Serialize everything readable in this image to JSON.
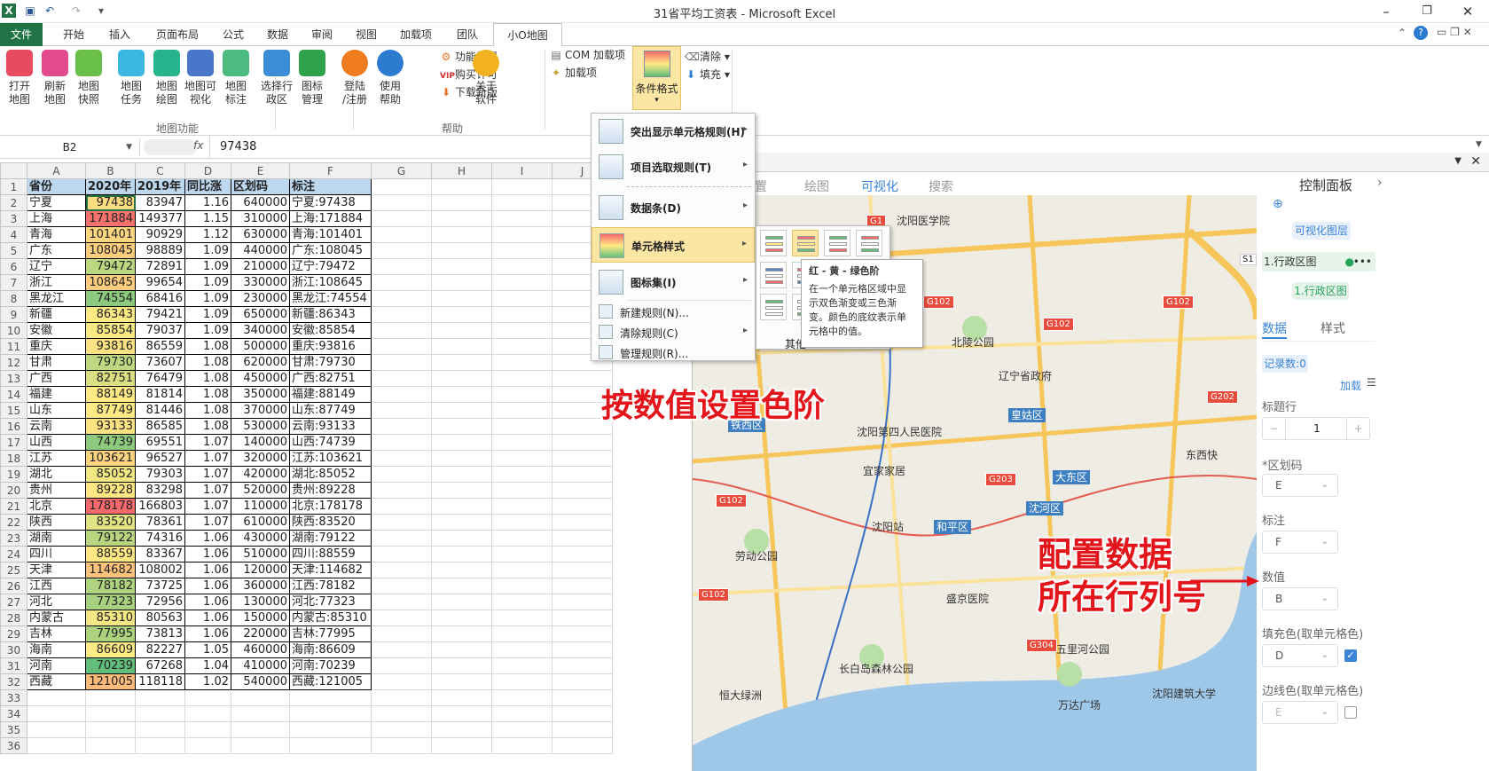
{
  "window": {
    "title": "31省平均工资表 - Microsoft Excel",
    "min": "–",
    "restore": "❐",
    "close": "✕"
  },
  "tabs": [
    "文件",
    "开始",
    "插入",
    "页面布局",
    "公式",
    "数据",
    "审阅",
    "视图",
    "加载项",
    "团队",
    "小O地图"
  ],
  "ribbon": {
    "group1": {
      "label": "地图功能",
      "buttons": [
        {
          "label": "打开\n地图",
          "icon": "flower-icon",
          "color": "#e84a5f"
        },
        {
          "label": "刷新\n地图",
          "icon": "refresh-icon",
          "color": "#e24a8d"
        },
        {
          "label": "地图\n快照",
          "icon": "camera-icon",
          "color": "#6abf4b"
        },
        {
          "label": "地图\n任务",
          "icon": "calendar-icon",
          "color": "#3cb6e3"
        },
        {
          "label": "地图\n绘图",
          "icon": "pen-icon",
          "color": "#27b38b"
        },
        {
          "label": "地图可\n视化",
          "icon": "image-icon",
          "color": "#4a76c9"
        },
        {
          "label": "地图\n标注",
          "icon": "flag-icon",
          "color": "#4cbb7f"
        },
        {
          "label": "选择行\n政区",
          "icon": "pin-icon",
          "color": "#3b8dd6"
        },
        {
          "label": "图标\n管理",
          "icon": "marker-icon",
          "color": "#2fa14b"
        }
      ]
    },
    "group2": {
      "label": "帮助",
      "buttons": [
        {
          "label": "登陆\n/注册",
          "icon": "user-icon",
          "color": "#ef7b1f"
        },
        {
          "label": "使用\n帮助",
          "icon": "help-icon",
          "color": "#2b7bd1"
        },
        {
          "label": "关于\n软件",
          "icon": "info-icon",
          "color": "#f2b21f"
        }
      ],
      "small": [
        "功能设置",
        "购买许可",
        "下载新版"
      ]
    },
    "group3": {
      "label": "辅",
      "small": [
        "COM 加载项",
        "加载项"
      ],
      "cond_format": "条件格式",
      "fill_small": [
        "清除",
        "填充"
      ]
    }
  },
  "formula": {
    "namebox": "B2",
    "fx": "fx",
    "value": "97438"
  },
  "sheet": {
    "col_headers": [
      "A",
      "B",
      "C",
      "D",
      "E",
      "F",
      "G",
      "H",
      "I",
      "J"
    ],
    "header_row": [
      "省份",
      "2020年",
      "2019年",
      "同比涨",
      "区划码",
      "标注"
    ],
    "rows": [
      [
        "宁夏",
        "97438",
        "83947",
        "1.16",
        "640000",
        "宁夏:97438"
      ],
      [
        "上海",
        "171884",
        "149377",
        "1.15",
        "310000",
        "上海:171884"
      ],
      [
        "青海",
        "101401",
        "90929",
        "1.12",
        "630000",
        "青海:101401"
      ],
      [
        "广东",
        "108045",
        "98889",
        "1.09",
        "440000",
        "广东:108045"
      ],
      [
        "辽宁",
        "79472",
        "72891",
        "1.09",
        "210000",
        "辽宁:79472"
      ],
      [
        "浙江",
        "108645",
        "99654",
        "1.09",
        "330000",
        "浙江:108645"
      ],
      [
        "黑龙江",
        "74554",
        "68416",
        "1.09",
        "230000",
        "黑龙江:74554"
      ],
      [
        "新疆",
        "86343",
        "79421",
        "1.09",
        "650000",
        "新疆:86343"
      ],
      [
        "安徽",
        "85854",
        "79037",
        "1.09",
        "340000",
        "安徽:85854"
      ],
      [
        "重庆",
        "93816",
        "86559",
        "1.08",
        "500000",
        "重庆:93816"
      ],
      [
        "甘肃",
        "79730",
        "73607",
        "1.08",
        "620000",
        "甘肃:79730"
      ],
      [
        "广西",
        "82751",
        "76479",
        "1.08",
        "450000",
        "广西:82751"
      ],
      [
        "福建",
        "88149",
        "81814",
        "1.08",
        "350000",
        "福建:88149"
      ],
      [
        "山东",
        "87749",
        "81446",
        "1.08",
        "370000",
        "山东:87749"
      ],
      [
        "云南",
        "93133",
        "86585",
        "1.08",
        "530000",
        "云南:93133"
      ],
      [
        "山西",
        "74739",
        "69551",
        "1.07",
        "140000",
        "山西:74739"
      ],
      [
        "江苏",
        "103621",
        "96527",
        "1.07",
        "320000",
        "江苏:103621"
      ],
      [
        "湖北",
        "85052",
        "79303",
        "1.07",
        "420000",
        "湖北:85052"
      ],
      [
        "贵州",
        "89228",
        "83298",
        "1.07",
        "520000",
        "贵州:89228"
      ],
      [
        "北京",
        "178178",
        "166803",
        "1.07",
        "110000",
        "北京:178178"
      ],
      [
        "陕西",
        "83520",
        "78361",
        "1.07",
        "610000",
        "陕西:83520"
      ],
      [
        "湖南",
        "79122",
        "74316",
        "1.06",
        "430000",
        "湖南:79122"
      ],
      [
        "四川",
        "88559",
        "83367",
        "1.06",
        "510000",
        "四川:88559"
      ],
      [
        "天津",
        "114682",
        "108002",
        "1.06",
        "120000",
        "天津:114682"
      ],
      [
        "江西",
        "78182",
        "73725",
        "1.06",
        "360000",
        "江西:78182"
      ],
      [
        "河北",
        "77323",
        "72956",
        "1.06",
        "130000",
        "河北:77323"
      ],
      [
        "内蒙古",
        "85310",
        "80563",
        "1.06",
        "150000",
        "内蒙古:85310"
      ],
      [
        "吉林",
        "77995",
        "73813",
        "1.06",
        "220000",
        "吉林:77995"
      ],
      [
        "海南",
        "86609",
        "82227",
        "1.05",
        "460000",
        "海南:86609"
      ],
      [
        "河南",
        "70239",
        "67268",
        "1.04",
        "410000",
        "河南:70239"
      ],
      [
        "西藏",
        "121005",
        "118118",
        "1.02",
        "540000",
        "西藏:121005"
      ]
    ],
    "row_numbers": [
      "1",
      "2",
      "3",
      "4",
      "5",
      "6",
      "7",
      "8",
      "9",
      "10",
      "11",
      "12",
      "13",
      "14",
      "15",
      "16",
      "17",
      "18",
      "19",
      "20",
      "21",
      "22",
      "23",
      "24",
      "25",
      "26",
      "27",
      "28",
      "29",
      "30",
      "31",
      "32",
      "33",
      "34",
      "35",
      "36"
    ]
  },
  "cf_menu": {
    "items": [
      {
        "label": "突出显示单元格规则(H)",
        "arrow": "▸"
      },
      {
        "label": "项目选取规则(T)",
        "arrow": "▸"
      },
      {
        "label": "数据条(D)",
        "arrow": "▸"
      },
      {
        "label": "单元格样式",
        "arrow": "▸"
      },
      {
        "label": "图标集(I)",
        "arrow": "▸"
      }
    ],
    "small": [
      {
        "label": "新建规则(N)...",
        "arrow": ""
      },
      {
        "label": "清除规则(C)",
        "arrow": "▸"
      },
      {
        "label": "管理规则(R)...",
        "arrow": ""
      }
    ],
    "other": "其他"
  },
  "tooltip": {
    "title": "红 - 黄 - 绿色阶",
    "body": "在一个单元格区域中显示双色渐变或三色渐变。颜色的底纹表示单元格中的值。"
  },
  "map_panel": {
    "nav": [
      "置",
      "绘图",
      "可视化",
      "搜索"
    ],
    "labels": [
      "沈阳医学院",
      "北陵公园",
      "辽宁省政府",
      "沈阳第四人民医院",
      "宜家家居",
      "沈阳站",
      "劳动公园",
      "盛京医院",
      "长白岛森林公园",
      "恒大绿洲",
      "万达广场",
      "沈阳建筑大学",
      "五里河公园",
      "东西快"
    ],
    "districts": [
      "铁西区",
      "皇姑区",
      "大东区",
      "沈河区",
      "和平区"
    ],
    "roads": [
      "G1",
      "G102",
      "G102",
      "G102",
      "G203",
      "G202",
      "G102",
      "G304",
      "G102"
    ],
    "annot1": "按数值设置色阶",
    "annot2": "配置数据",
    "annot3": "所在行列号"
  },
  "control": {
    "title": "控制面板",
    "vis_layer": "可视化图层",
    "layer_name": "1.行政区图",
    "layer_tag": "1.行政区图",
    "tabs": [
      "数据",
      "样式"
    ],
    "record_count": "记录数:0",
    "load": "加载",
    "header_row_label": "标题行",
    "header_row_value": "1",
    "region_code_label": "*区划码",
    "region_code_value": "E",
    "label_label": "标注",
    "label_value": "F",
    "value_label": "数值",
    "value_value": "B",
    "fill_label": "填充色(取单元格色)",
    "fill_value": "D",
    "border_label": "边线色(取单元格色)",
    "border_value": "E",
    "tag_s1": "S1"
  },
  "colors": {
    "accent": "#217346",
    "header_fill": "#bdd7ee",
    "menu_highlight": "#fbe6a4",
    "scale_low": "#63be7b",
    "scale_mid": "#ffeb84",
    "scale_high": "#f8696b"
  }
}
